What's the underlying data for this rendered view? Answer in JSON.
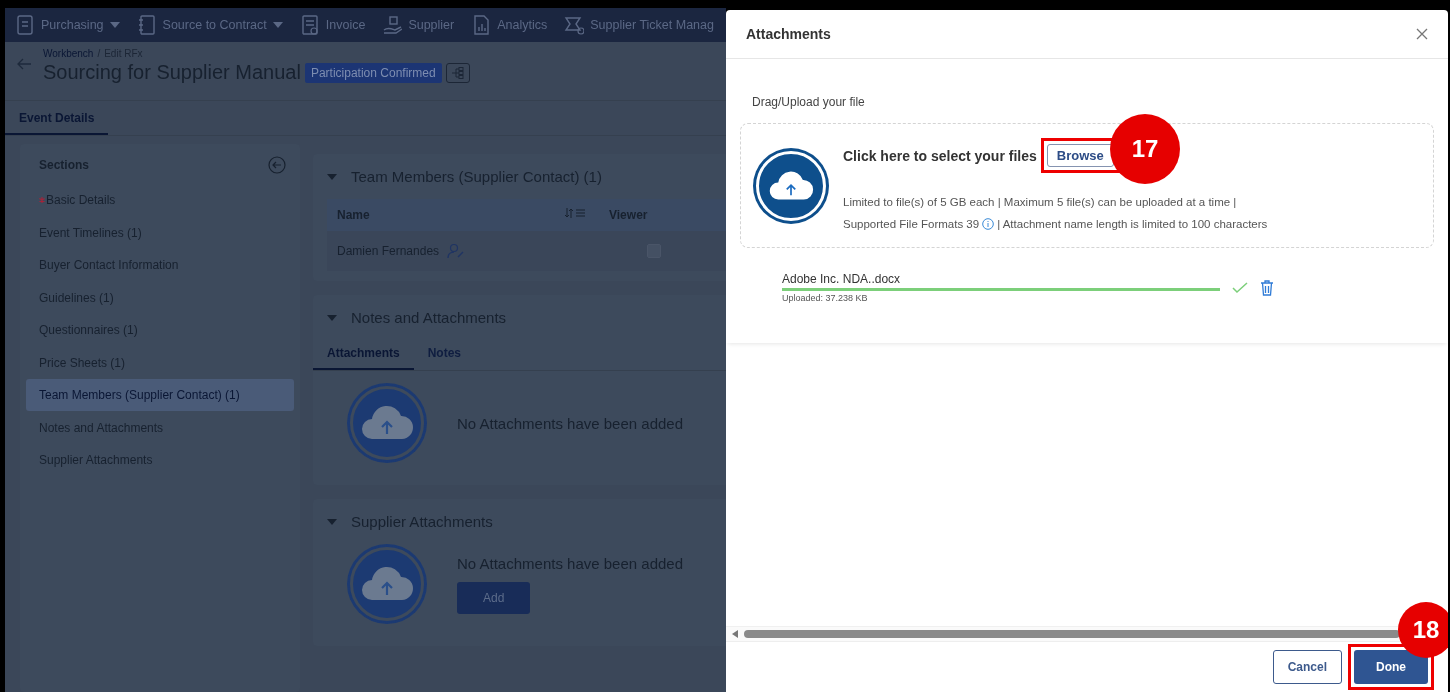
{
  "nav": {
    "items": [
      {
        "label": "Purchasing",
        "dropdown": true
      },
      {
        "label": "Source to Contract",
        "dropdown": true
      },
      {
        "label": "Invoice",
        "dropdown": false
      },
      {
        "label": "Supplier",
        "dropdown": false
      },
      {
        "label": "Analytics",
        "dropdown": false
      },
      {
        "label": "Supplier Ticket Manag",
        "dropdown": false
      }
    ]
  },
  "header": {
    "breadcrumb": [
      "Workbench",
      "Edit RFx"
    ],
    "breadcrumb_separator": "/",
    "title": "Sourcing for Supplier Manual",
    "status_badge": "Participation Confirmed"
  },
  "tabs": [
    {
      "label": "Event Details",
      "selected": true
    }
  ],
  "sidebar": {
    "title": "Sections",
    "items": [
      {
        "label": "Basic Details",
        "required": true,
        "selected": false
      },
      {
        "label": "Event Timelines (1)",
        "required": false,
        "selected": false
      },
      {
        "label": "Buyer Contact Information",
        "required": false,
        "selected": false
      },
      {
        "label": "Guidelines (1)",
        "required": false,
        "selected": false
      },
      {
        "label": "Questionnaires (1)",
        "required": false,
        "selected": false
      },
      {
        "label": "Price Sheets (1)",
        "required": false,
        "selected": false
      },
      {
        "label": "Team Members (Supplier Contact) (1)",
        "required": false,
        "selected": true
      },
      {
        "label": "Notes and Attachments",
        "required": false,
        "selected": false
      },
      {
        "label": "Supplier Attachments",
        "required": false,
        "selected": false
      }
    ]
  },
  "team_members": {
    "title": "Team Members (Supplier Contact) (1)",
    "columns": [
      "Name",
      "Viewer"
    ],
    "rows": [
      {
        "name": "Damien Fernandes",
        "viewer_checked": false
      }
    ]
  },
  "notes_attachments": {
    "title": "Notes and Attachments",
    "tabs": [
      {
        "label": "Attachments",
        "selected": true
      },
      {
        "label": "Notes",
        "selected": false
      }
    ],
    "empty_message": "No Attachments have been added"
  },
  "supplier_attachments": {
    "title": "Supplier Attachments",
    "empty_message": "No Attachments have been added",
    "add_button": "Add"
  },
  "drawer": {
    "title": "Attachments",
    "drop_label": "Drag/Upload your file",
    "prompt": "Click here to select your files",
    "browse_button": "Browse",
    "limits_line_1": "Limited to file(s) of 5 GB each | Maximum 5 file(s) can be uploaded at a time |",
    "formats": "Supported File Formats 39",
    "limits_line_2": "| Attachment name length is limited to 100 characters",
    "files": [
      {
        "name": "Adobe Inc. NDA..docx",
        "status": "Uploaded: 37.238 KB",
        "level": 1
      }
    ],
    "cancel_button": "Cancel",
    "done_button": "Done"
  },
  "callouts": [
    {
      "label": "17"
    },
    {
      "label": "18"
    }
  ]
}
